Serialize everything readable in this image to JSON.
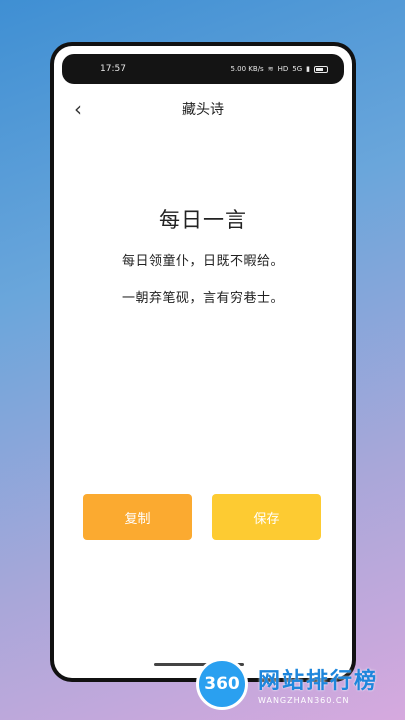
{
  "status": {
    "time": "17:57",
    "net_speed": "5.00 KB/s",
    "hd": "HD",
    "signal": "5G"
  },
  "nav": {
    "back_icon": "‹",
    "title": "藏头诗"
  },
  "content": {
    "heading": "每日一言",
    "line1": "每日领童仆，日既不暇给。",
    "line2": "一朝弃笔砚，言有穷巷士。"
  },
  "buttons": {
    "copy": "复制",
    "save": "保存"
  },
  "colors": {
    "copy_btn": "#fbaa30",
    "save_btn": "#fdcb32"
  },
  "watermark": {
    "logo": "360",
    "main": "网站排行榜",
    "sub": "WANGZHAN360.CN"
  }
}
